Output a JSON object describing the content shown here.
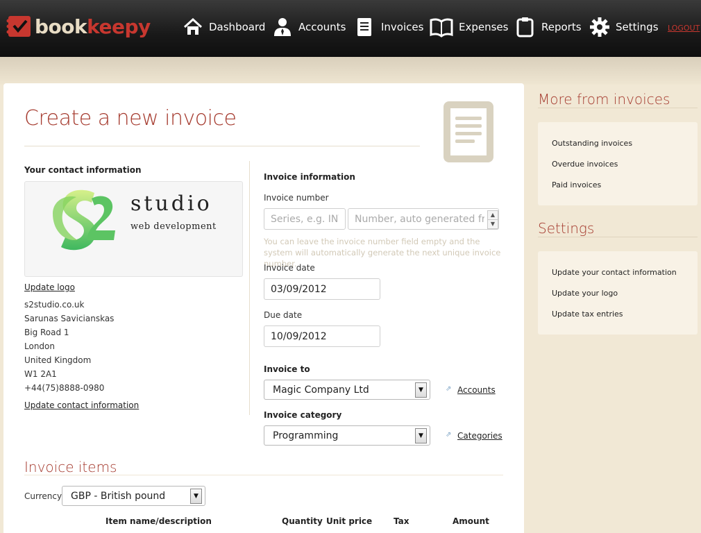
{
  "brand": {
    "part1": "book",
    "part2": "keepy"
  },
  "nav": [
    {
      "label": "Dashboard",
      "icon": "home-icon"
    },
    {
      "label": "Accounts",
      "icon": "user-icon"
    },
    {
      "label": "Invoices",
      "icon": "invoice-icon"
    },
    {
      "label": "Expenses",
      "icon": "book-icon"
    },
    {
      "label": "Reports",
      "icon": "clipboard-icon"
    },
    {
      "label": "Settings",
      "icon": "gear-icon"
    }
  ],
  "logout_label": "LOGOUT",
  "page": {
    "title": "Create a new invoice"
  },
  "contact": {
    "heading": "Your contact information",
    "logo_name": "studio",
    "logo_tagline": "web development",
    "update_logo": "Update logo",
    "lines": [
      "s2studio.co.uk",
      "Sarunas Savicianskas",
      "Big Road 1",
      "London",
      "United Kingdom",
      "W1 2A1",
      "+44(75)8888-0980"
    ],
    "update_contact": "Update contact information"
  },
  "invoice_info": {
    "heading": "Invoice information",
    "number_label": "Invoice number",
    "series_placeholder": "Series, e.g. INV-",
    "number_placeholder": "Number, auto generated from",
    "hint": "You can leave the invoice number field empty and the system will automatically generate the next unique invoice number.",
    "date_label": "Invoice date",
    "date_value": "03/09/2012",
    "due_label": "Due date",
    "due_value": "10/09/2012",
    "to_label": "Invoice to",
    "to_value": "Magic Company Ltd",
    "accounts_link": "Accounts",
    "category_label": "Invoice category",
    "category_value": "Programming",
    "categories_link": "Categories"
  },
  "items": {
    "title": "Invoice items",
    "currency_label": "Currency",
    "currency_value": "GBP - British pound",
    "columns": [
      "Item name/description",
      "Quantity",
      "Unit price",
      "Tax",
      "Amount"
    ]
  },
  "sidebar": {
    "more_title": "More from invoices",
    "more_links": [
      "Outstanding invoices",
      "Overdue invoices",
      "Paid invoices"
    ],
    "settings_title": "Settings",
    "settings_links": [
      "Update your contact information",
      "Update your logo",
      "Update tax entries"
    ]
  },
  "colors": {
    "accent": "#a53a2e",
    "brand_red": "#c7372f",
    "background": "#f1e8d5"
  }
}
